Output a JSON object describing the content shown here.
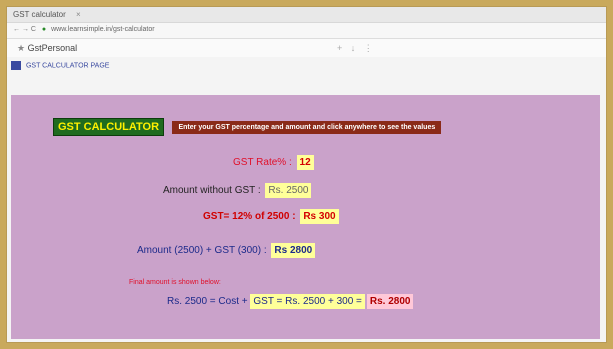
{
  "browser": {
    "tab_title": "GST calculator",
    "tab_close": "×",
    "address_nav": "← → C",
    "address_url": "www.learnsimple.in/gst-calculator",
    "bookmark_star": "★",
    "bookmark_label": "GstPersonal",
    "bookmark_icons": "+ ↓ ⋮"
  },
  "subnav": {
    "label": "GST CALCULATOR PAGE"
  },
  "calculator": {
    "title": "GST CALCULATOR",
    "instructions": "Enter your GST percentage and amount and click anywhere to see the values",
    "rate_label": "GST Rate% :",
    "rate_value": "12",
    "amount_label": "Amount without GST : ",
    "amount_value": "Rs. 2500",
    "gst_label": "GST= 12% of 2500 :",
    "gst_value": "Rs 300",
    "total_label": "Amount (2500) + GST (300) :",
    "total_value": "Rs 2800",
    "note": "Final amount is shown below:",
    "final_prefix": "Rs. 2500  = Cost + ",
    "final_eq": "GST = Rs. 2500 + 300 =",
    "final_value": "Rs. 2800"
  },
  "colors": {
    "panel_bg": "#caa2ca",
    "title_bg": "#1f6b1f",
    "title_fg": "#fff000",
    "instr_bg": "#8a2a18",
    "highlight": "#ffff99"
  }
}
